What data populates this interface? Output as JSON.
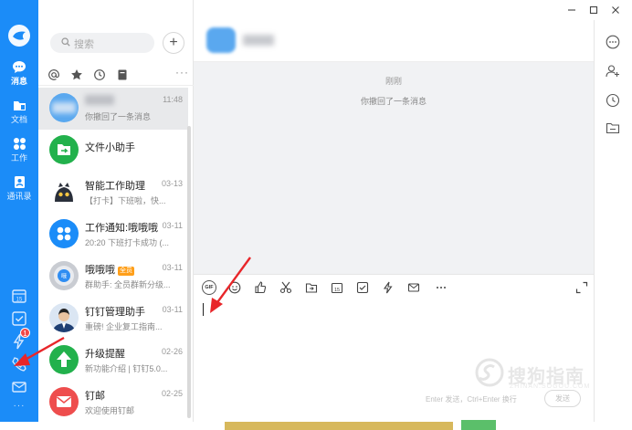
{
  "rail": {
    "items": [
      {
        "name": "messages",
        "label": "消息",
        "icon": "chat-bubble-icon",
        "active": true
      },
      {
        "name": "docs",
        "label": "文档",
        "icon": "folder-icon",
        "active": false
      },
      {
        "name": "work",
        "label": "工作",
        "icon": "apps-grid-icon",
        "active": false
      },
      {
        "name": "contacts",
        "label": "通讯录",
        "icon": "contacts-icon",
        "active": false
      }
    ],
    "tools": [
      "calendar-icon",
      "task-check-icon",
      "ding-lightning-icon",
      "phone-icon",
      "mail-icon",
      "more-dots-icon"
    ],
    "badge": "1",
    "more": "···",
    "accent": "#1b8cf8"
  },
  "search": {
    "placeholder": "搜索"
  },
  "add_button": "+",
  "filter_more": "···",
  "conversations": [
    {
      "name": "",
      "time": "11:48",
      "preview": "你撤回了一条消息",
      "selected": true,
      "avatar": "blurred-contact"
    },
    {
      "name": "文件小助手",
      "time": "",
      "preview": "",
      "avatar": "file-helper-icon"
    },
    {
      "name": "智能工作助理",
      "time": "03-13",
      "preview": "【打卡】下班啦，快...",
      "avatar": "robot-avatar"
    },
    {
      "name": "工作通知:哦哦哦",
      "time": "03-11",
      "preview": "20:20 下班打卡成功 (...",
      "avatar": "work-notice-icon"
    },
    {
      "name": "哦哦哦",
      "tag": "全员",
      "time": "03-11",
      "preview": "群助手: 全员群新分级...",
      "avatar": "group-avatar"
    },
    {
      "name": "钉钉管理助手",
      "time": "03-11",
      "preview": "重磅! 企业复工指南...",
      "avatar": "person-photo"
    },
    {
      "name": "升级提醒",
      "time": "02-26",
      "preview": "新功能介绍 | 钉钉5.0...",
      "avatar": "upgrade-icon"
    },
    {
      "name": "钉邮",
      "time": "02-25",
      "preview": "欢迎使用钉邮",
      "avatar": "ding-mail-icon"
    }
  ],
  "chat": {
    "time_label": "刚刚",
    "system_message": "你撤回了一条消息",
    "send_hint": "Enter 发送，Ctrl+Enter 换行",
    "send_label": "发送",
    "gif_label": "GIF"
  },
  "watermark": {
    "text": "搜狗指南",
    "sub": "ZHINAN.SOGOU.COM"
  }
}
